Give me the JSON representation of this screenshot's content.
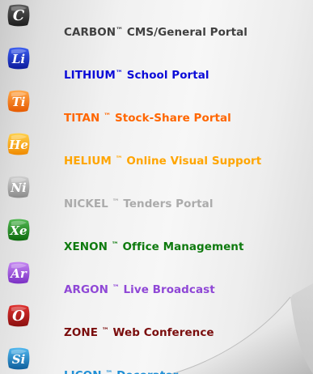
{
  "products": [
    {
      "brand": "CARBON",
      "rest": " CMS/General Portal",
      "spacer": "",
      "color": "#404040",
      "glyph": "C",
      "icon_colors": [
        "#5a5a5a",
        "#1c1c1c"
      ]
    },
    {
      "brand": "LITHIUM",
      "rest": " School Portal",
      "spacer": "",
      "color": "#0b0bd8",
      "glyph": "Li",
      "icon_colors": [
        "#3c5ef0",
        "#0d1b9c"
      ]
    },
    {
      "brand": "TITAN",
      "rest": " Stock-Share Portal",
      "spacer": " ",
      "color": "#ff6600",
      "glyph": "Ti",
      "icon_colors": [
        "#ffa84a",
        "#e65a00"
      ]
    },
    {
      "brand": "HELIUM",
      "rest": " Online Visual Support",
      "spacer": " ",
      "color": "#ffa500",
      "glyph": "He",
      "icon_colors": [
        "#ffd04a",
        "#f08a00"
      ]
    },
    {
      "brand": "NICKEL",
      "rest": " Tenders Portal",
      "spacer": " ",
      "color": "#ababab",
      "glyph": "Ni",
      "icon_colors": [
        "#cfcfcf",
        "#8a8a8a"
      ]
    },
    {
      "brand": "XENON",
      "rest": " Office Management",
      "spacer": " ",
      "color": "#0e7a0e",
      "glyph": "Xe",
      "icon_colors": [
        "#52b852",
        "#0d6a0d"
      ]
    },
    {
      "brand": "ARGON",
      "rest": " Live Broadcast",
      "spacer": " ",
      "color": "#8f47d6",
      "glyph": "Ar",
      "icon_colors": [
        "#c586f2",
        "#7a2fc4"
      ]
    },
    {
      "brand": "ZONE",
      "rest": " Web Conference",
      "spacer": " ",
      "color": "#7a0d0d",
      "glyph": "O",
      "icon_colors": [
        "#e0312f",
        "#8a0f0f"
      ]
    },
    {
      "brand": "LICON",
      "rest": " Decorator",
      "spacer": " ",
      "color": "#1f8fd6",
      "glyph": "Si",
      "icon_colors": [
        "#4fb7ef",
        "#0f5f9c"
      ]
    }
  ],
  "trademark": "™"
}
